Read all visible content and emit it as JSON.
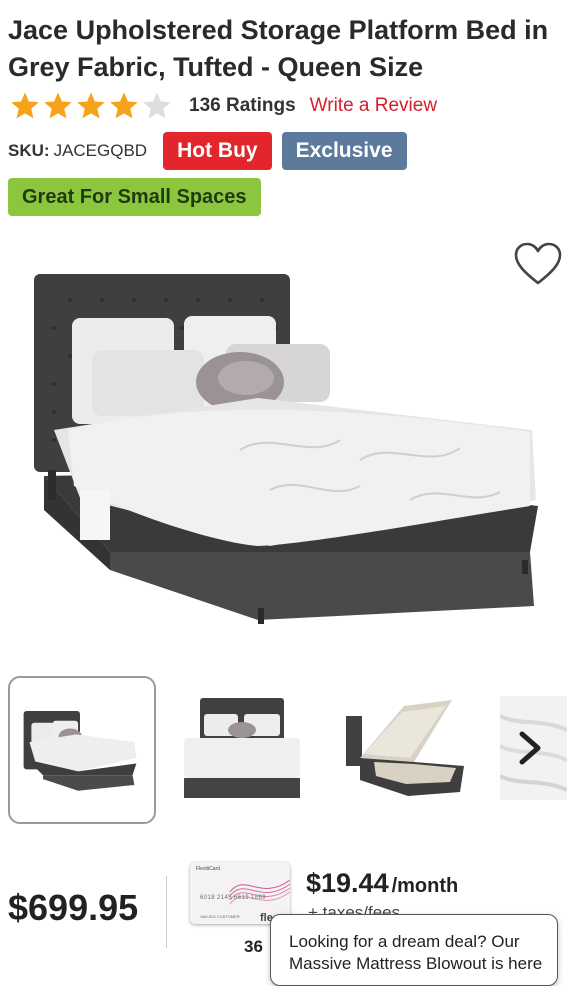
{
  "product": {
    "title": "Jace Upholstered Storage Platform Bed in Grey Fabric, Tufted - Queen Size",
    "rating": 4,
    "rating_max": 5,
    "ratings_count": "136 Ratings",
    "write_review": "Write a Review",
    "sku_label": "SKU:",
    "sku_value": "JACEGQBD",
    "badges": {
      "hot_buy": "Hot Buy",
      "exclusive": "Exclusive",
      "small_spaces": "Great For Small Spaces"
    }
  },
  "colors": {
    "star_filled": "#f7a21b",
    "star_empty": "#dddddd",
    "review_link": "#d31f2b",
    "hot_buy": "#e3262b",
    "exclusive": "#5b7a9c",
    "small_spaces": "#8cc63f"
  },
  "gallery": {
    "favorite_icon": "heart-outline-icon",
    "hero_image": "grey-tufted-bed-photo",
    "thumbnails": [
      "bed-front-angle",
      "bed-front",
      "bed-storage-open",
      "bed-fabric-closeup"
    ],
    "next_icon": "chevron-right-icon"
  },
  "pricing": {
    "price": "$699.95",
    "card_brand": "FlexitiCard",
    "card_number": "6018 2145 6619 1869",
    "card_holder": "VALUED CUSTOMER",
    "financing_months": "36",
    "monthly_amount": "$19.44",
    "monthly_unit": "/month",
    "taxes_fees": "+ taxes/fees",
    "brand_fragment": "fle"
  },
  "popup": {
    "message": "Looking for a dream deal? Our Massive Mattress Blowout is here"
  }
}
